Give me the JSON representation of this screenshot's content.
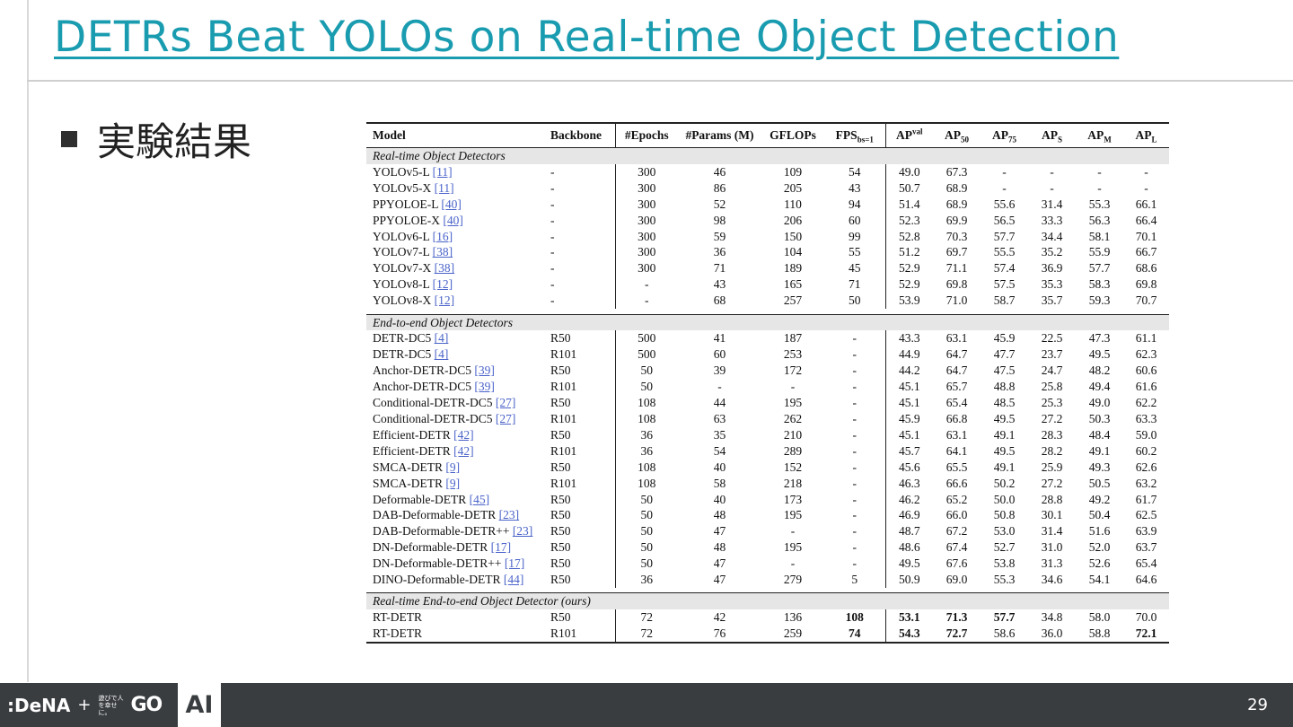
{
  "slide": {
    "title": "DETRs Beat YOLOs on Real-time Object Detection",
    "bullet": "実験結果",
    "page_number": "29"
  },
  "footer": {
    "brand": ":DeNA",
    "plus": "+",
    "tagline": "遊びで人を幸せに。",
    "go_logo": "GO",
    "ai_label": "AI"
  },
  "table": {
    "columns": [
      "Model",
      "Backbone",
      "#Epochs",
      "#Params (M)",
      "GFLOPs",
      "FPS",
      "bs=1",
      "AP",
      "val",
      "AP",
      "50",
      "AP",
      "75",
      "AP",
      "S",
      "AP",
      "M",
      "AP",
      "L"
    ],
    "sections": [
      {
        "title": "Real-time Object Detectors",
        "rows": [
          {
            "model": "YOLOv5-L",
            "ref": "[11]",
            "backbone": "-",
            "epochs": "300",
            "params": "46",
            "gflops": "109",
            "fps": "54",
            "ap": "49.0",
            "ap50": "67.3",
            "ap75": "-",
            "aps": "-",
            "apm": "-",
            "apl": "-"
          },
          {
            "model": "YOLOv5-X",
            "ref": "[11]",
            "backbone": "-",
            "epochs": "300",
            "params": "86",
            "gflops": "205",
            "fps": "43",
            "ap": "50.7",
            "ap50": "68.9",
            "ap75": "-",
            "aps": "-",
            "apm": "-",
            "apl": "-"
          },
          {
            "model": "PPYOLOE-L",
            "ref": "[40]",
            "backbone": "-",
            "epochs": "300",
            "params": "52",
            "gflops": "110",
            "fps": "94",
            "ap": "51.4",
            "ap50": "68.9",
            "ap75": "55.6",
            "aps": "31.4",
            "apm": "55.3",
            "apl": "66.1"
          },
          {
            "model": "PPYOLOE-X",
            "ref": "[40]",
            "backbone": "-",
            "epochs": "300",
            "params": "98",
            "gflops": "206",
            "fps": "60",
            "ap": "52.3",
            "ap50": "69.9",
            "ap75": "56.5",
            "aps": "33.3",
            "apm": "56.3",
            "apl": "66.4"
          },
          {
            "model": "YOLOv6-L",
            "ref": "[16]",
            "backbone": "-",
            "epochs": "300",
            "params": "59",
            "gflops": "150",
            "fps": "99",
            "ap": "52.8",
            "ap50": "70.3",
            "ap75": "57.7",
            "aps": "34.4",
            "apm": "58.1",
            "apl": "70.1"
          },
          {
            "model": "YOLOv7-L",
            "ref": "[38]",
            "backbone": "-",
            "epochs": "300",
            "params": "36",
            "gflops": "104",
            "fps": "55",
            "ap": "51.2",
            "ap50": "69.7",
            "ap75": "55.5",
            "aps": "35.2",
            "apm": "55.9",
            "apl": "66.7"
          },
          {
            "model": "YOLOv7-X",
            "ref": "[38]",
            "backbone": "-",
            "epochs": "300",
            "params": "71",
            "gflops": "189",
            "fps": "45",
            "ap": "52.9",
            "ap50": "71.1",
            "ap75": "57.4",
            "aps": "36.9",
            "apm": "57.7",
            "apl": "68.6"
          },
          {
            "model": "YOLOv8-L",
            "ref": "[12]",
            "backbone": "-",
            "epochs": "-",
            "params": "43",
            "gflops": "165",
            "fps": "71",
            "ap": "52.9",
            "ap50": "69.8",
            "ap75": "57.5",
            "aps": "35.3",
            "apm": "58.3",
            "apl": "69.8"
          },
          {
            "model": "YOLOv8-X",
            "ref": "[12]",
            "backbone": "-",
            "epochs": "-",
            "params": "68",
            "gflops": "257",
            "fps": "50",
            "ap": "53.9",
            "ap50": "71.0",
            "ap75": "58.7",
            "aps": "35.7",
            "apm": "59.3",
            "apl": "70.7"
          }
        ]
      },
      {
        "title": "End-to-end Object Detectors",
        "rows": [
          {
            "model": "DETR-DC5",
            "ref": "[4]",
            "backbone": "R50",
            "epochs": "500",
            "params": "41",
            "gflops": "187",
            "fps": "-",
            "ap": "43.3",
            "ap50": "63.1",
            "ap75": "45.9",
            "aps": "22.5",
            "apm": "47.3",
            "apl": "61.1"
          },
          {
            "model": "DETR-DC5",
            "ref": "[4]",
            "backbone": "R101",
            "epochs": "500",
            "params": "60",
            "gflops": "253",
            "fps": "-",
            "ap": "44.9",
            "ap50": "64.7",
            "ap75": "47.7",
            "aps": "23.7",
            "apm": "49.5",
            "apl": "62.3"
          },
          {
            "model": "Anchor-DETR-DC5",
            "ref": "[39]",
            "backbone": "R50",
            "epochs": "50",
            "params": "39",
            "gflops": "172",
            "fps": "-",
            "ap": "44.2",
            "ap50": "64.7",
            "ap75": "47.5",
            "aps": "24.7",
            "apm": "48.2",
            "apl": "60.6"
          },
          {
            "model": "Anchor-DETR-DC5",
            "ref": "[39]",
            "backbone": "R101",
            "epochs": "50",
            "params": "-",
            "gflops": "-",
            "fps": "-",
            "ap": "45.1",
            "ap50": "65.7",
            "ap75": "48.8",
            "aps": "25.8",
            "apm": "49.4",
            "apl": "61.6"
          },
          {
            "model": "Conditional-DETR-DC5",
            "ref": "[27]",
            "backbone": "R50",
            "epochs": "108",
            "params": "44",
            "gflops": "195",
            "fps": "-",
            "ap": "45.1",
            "ap50": "65.4",
            "ap75": "48.5",
            "aps": "25.3",
            "apm": "49.0",
            "apl": "62.2"
          },
          {
            "model": "Conditional-DETR-DC5",
            "ref": "[27]",
            "backbone": "R101",
            "epochs": "108",
            "params": "63",
            "gflops": "262",
            "fps": "-",
            "ap": "45.9",
            "ap50": "66.8",
            "ap75": "49.5",
            "aps": "27.2",
            "apm": "50.3",
            "apl": "63.3"
          },
          {
            "model": "Efficient-DETR",
            "ref": "[42]",
            "backbone": "R50",
            "epochs": "36",
            "params": "35",
            "gflops": "210",
            "fps": "-",
            "ap": "45.1",
            "ap50": "63.1",
            "ap75": "49.1",
            "aps": "28.3",
            "apm": "48.4",
            "apl": "59.0"
          },
          {
            "model": "Efficient-DETR",
            "ref": "[42]",
            "backbone": "R101",
            "epochs": "36",
            "params": "54",
            "gflops": "289",
            "fps": "-",
            "ap": "45.7",
            "ap50": "64.1",
            "ap75": "49.5",
            "aps": "28.2",
            "apm": "49.1",
            "apl": "60.2"
          },
          {
            "model": "SMCA-DETR",
            "ref": "[9]",
            "backbone": "R50",
            "epochs": "108",
            "params": "40",
            "gflops": "152",
            "fps": "-",
            "ap": "45.6",
            "ap50": "65.5",
            "ap75": "49.1",
            "aps": "25.9",
            "apm": "49.3",
            "apl": "62.6"
          },
          {
            "model": "SMCA-DETR",
            "ref": "[9]",
            "backbone": "R101",
            "epochs": "108",
            "params": "58",
            "gflops": "218",
            "fps": "-",
            "ap": "46.3",
            "ap50": "66.6",
            "ap75": "50.2",
            "aps": "27.2",
            "apm": "50.5",
            "apl": "63.2"
          },
          {
            "model": "Deformable-DETR",
            "ref": "[45]",
            "backbone": "R50",
            "epochs": "50",
            "params": "40",
            "gflops": "173",
            "fps": "-",
            "ap": "46.2",
            "ap50": "65.2",
            "ap75": "50.0",
            "aps": "28.8",
            "apm": "49.2",
            "apl": "61.7"
          },
          {
            "model": "DAB-Deformable-DETR",
            "ref": "[23]",
            "backbone": "R50",
            "epochs": "50",
            "params": "48",
            "gflops": "195",
            "fps": "-",
            "ap": "46.9",
            "ap50": "66.0",
            "ap75": "50.8",
            "aps": "30.1",
            "apm": "50.4",
            "apl": "62.5"
          },
          {
            "model": "DAB-Deformable-DETR++",
            "ref": "[23]",
            "backbone": "R50",
            "epochs": "50",
            "params": "47",
            "gflops": "-",
            "fps": "-",
            "ap": "48.7",
            "ap50": "67.2",
            "ap75": "53.0",
            "aps": "31.4",
            "apm": "51.6",
            "apl": "63.9"
          },
          {
            "model": "DN-Deformable-DETR",
            "ref": "[17]",
            "backbone": "R50",
            "epochs": "50",
            "params": "48",
            "gflops": "195",
            "fps": "-",
            "ap": "48.6",
            "ap50": "67.4",
            "ap75": "52.7",
            "aps": "31.0",
            "apm": "52.0",
            "apl": "63.7"
          },
          {
            "model": "DN-Deformable-DETR++",
            "ref": "[17]",
            "backbone": "R50",
            "epochs": "50",
            "params": "47",
            "gflops": "-",
            "fps": "-",
            "ap": "49.5",
            "ap50": "67.6",
            "ap75": "53.8",
            "aps": "31.3",
            "apm": "52.6",
            "apl": "65.4"
          },
          {
            "model": "DINO-Deformable-DETR",
            "ref": "[44]",
            "backbone": "R50",
            "epochs": "36",
            "params": "47",
            "gflops": "279",
            "fps": "5",
            "ap": "50.9",
            "ap50": "69.0",
            "ap75": "55.3",
            "aps": "34.6",
            "apm": "54.1",
            "apl": "64.6"
          }
        ]
      },
      {
        "title": "Real-time End-to-end Object Detector (ours)",
        "rows": [
          {
            "model": "RT-DETR",
            "ref": "",
            "backbone": "R50",
            "epochs": "72",
            "params": "42",
            "gflops": "136",
            "fps": "108",
            "ap": "53.1",
            "ap50": "71.3",
            "ap75": "57.7",
            "aps": "34.8",
            "apm": "58.0",
            "apl": "70.0",
            "bold": [
              "fps",
              "ap",
              "ap50",
              "ap75"
            ]
          },
          {
            "model": "RT-DETR",
            "ref": "",
            "backbone": "R101",
            "epochs": "72",
            "params": "76",
            "gflops": "259",
            "fps": "74",
            "ap": "54.3",
            "ap50": "72.7",
            "ap75": "58.6",
            "aps": "36.0",
            "apm": "58.8",
            "apl": "72.1",
            "bold": [
              "fps",
              "ap",
              "ap50",
              "apl"
            ]
          }
        ]
      }
    ]
  },
  "colors": {
    "title": "#1a9cb0",
    "footer_bg": "#3a3d40",
    "section_bg": "#e6e6e6",
    "ref_link": "#4a63c9"
  }
}
